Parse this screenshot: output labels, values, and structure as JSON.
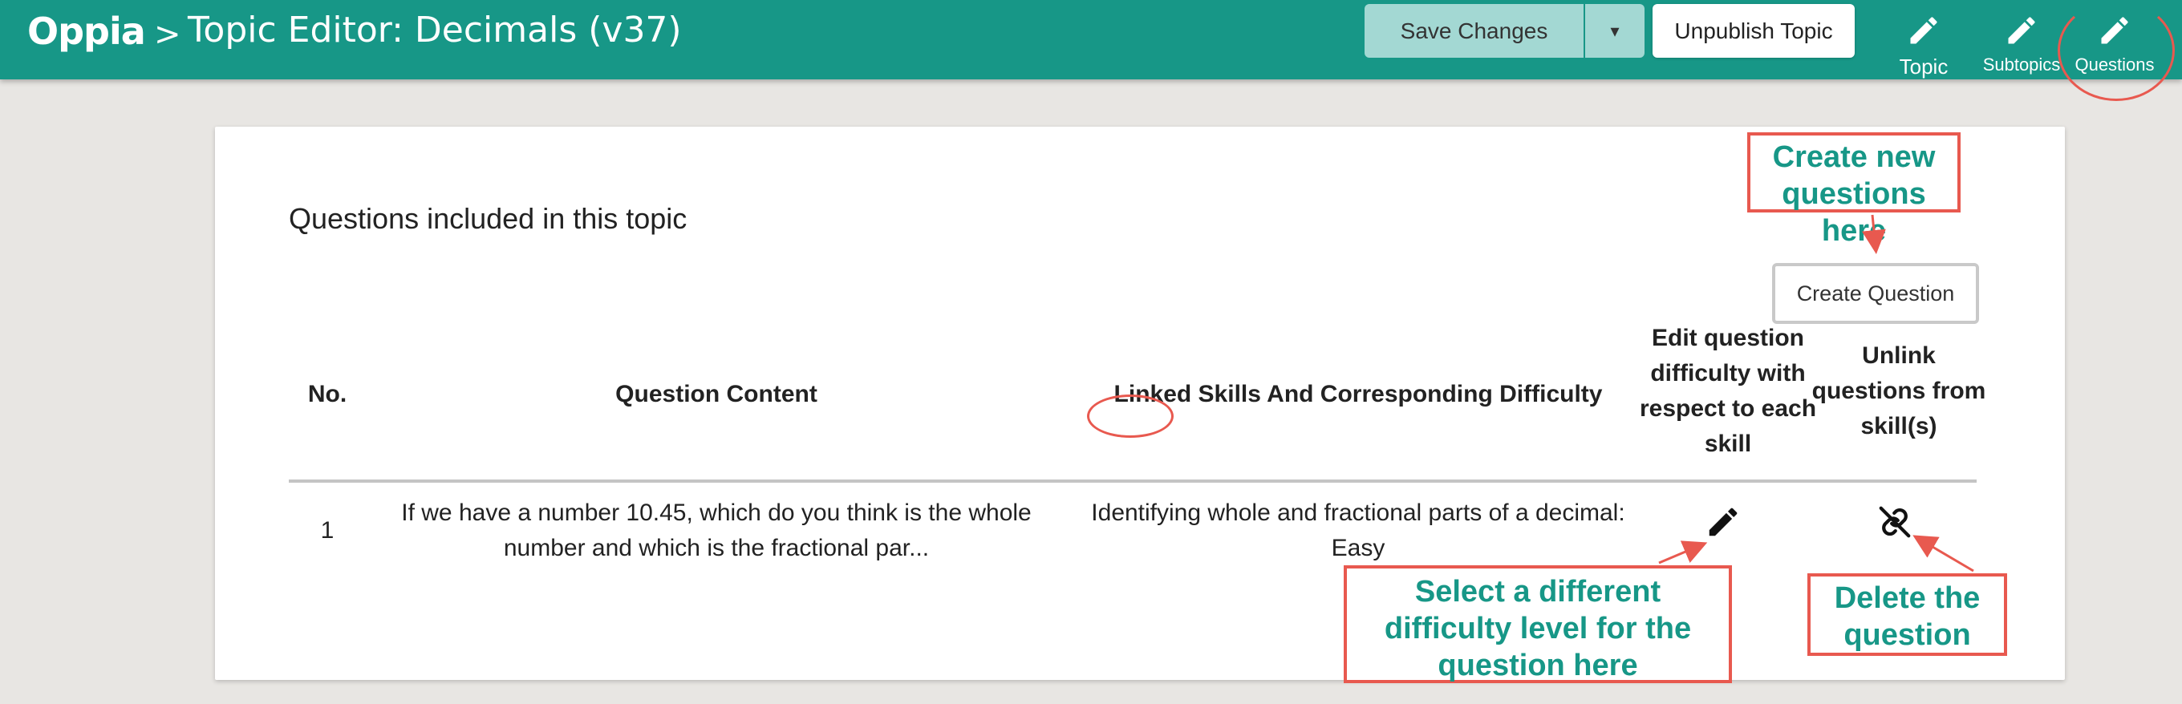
{
  "header": {
    "logo": "Oppia",
    "separator": ">",
    "title": "Topic Editor: Decimals (v37)",
    "save_label": "Save Changes",
    "save_caret": "▾",
    "unpublish_label": "Unpublish Topic",
    "nav": {
      "topic": "Topic",
      "subtopics": "Subtopics",
      "questions": "Questions"
    },
    "colors": {
      "bar": "#179787",
      "save_bg": "#a3d8d3"
    }
  },
  "main": {
    "section_title": "Questions included in this topic",
    "create_question_label": "Create Question",
    "table": {
      "headers": {
        "no": "No.",
        "content": "Question Content",
        "skills": "Linked Skills And Corresponding Difficulty",
        "edit_1": "Edit question",
        "edit_2": "difficulty with",
        "edit_3": "respect to each",
        "edit_4": "skill",
        "unlink_1": "Unlink",
        "unlink_2": "questions from",
        "unlink_3": "skill(s)"
      },
      "rows": [
        {
          "no": "1",
          "content_1": "If we have a number 10.45, which do you think is the whole",
          "content_2": "number and which is the fractional par...",
          "skill": "Identifying whole and fractional parts of a decimal:",
          "difficulty": "Easy"
        }
      ]
    }
  },
  "annotations": {
    "create_1": "Create new",
    "create_2": "questions here",
    "diff_1": "Select a different",
    "diff_2": "difficulty level for the",
    "diff_3": "question here",
    "delete_1": "Delete the",
    "delete_2": "question",
    "color": "#e8594f",
    "text_color": "#179787"
  }
}
